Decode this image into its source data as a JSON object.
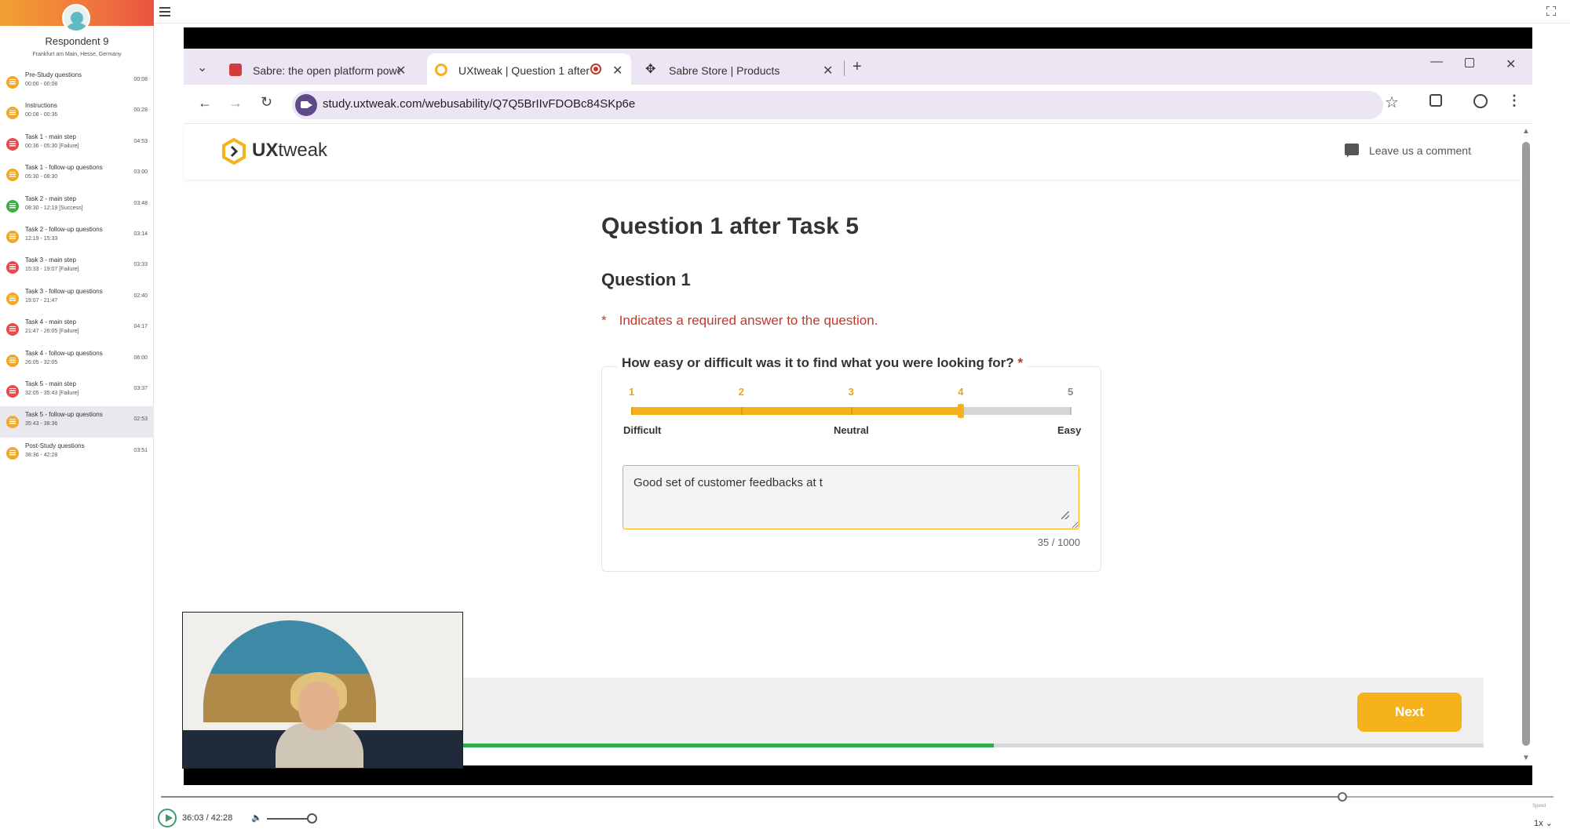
{
  "sidebar": {
    "respondent_name": "Respondent 9",
    "respondent_location": "Frankfurt am Main, Hesse, Germany",
    "items": [
      {
        "name": "Pre-Study questions",
        "range": "00:00 - 00:08",
        "duration": "00:08",
        "color": "#f4a825"
      },
      {
        "name": "Instructions",
        "range": "00:08 - 00:36",
        "duration": "00:28",
        "color": "#f4a825"
      },
      {
        "name": "Task 1 - main step",
        "range": "00:36 - 05:30 [Failure]",
        "duration": "04:53",
        "color": "#e94b4b"
      },
      {
        "name": "Task 1 - follow-up questions",
        "range": "05:30 - 08:30",
        "duration": "03:00",
        "color": "#f4a825"
      },
      {
        "name": "Task 2 - main step",
        "range": "08:30 - 12:19 [Success]",
        "duration": "03:48",
        "color": "#3fae49"
      },
      {
        "name": "Task 2 - follow-up questions",
        "range": "12:19 - 15:33",
        "duration": "03:14",
        "color": "#f4a825"
      },
      {
        "name": "Task 3 - main step",
        "range": "15:33 - 19:07 [Failure]",
        "duration": "03:33",
        "color": "#e94b4b"
      },
      {
        "name": "Task 3 - follow-up questions",
        "range": "19:07 - 21:47",
        "duration": "02:40",
        "color": "#f4a825"
      },
      {
        "name": "Task 4 - main step",
        "range": "21:47 - 26:05 [Failure]",
        "duration": "04:17",
        "color": "#e94b4b"
      },
      {
        "name": "Task 4 - follow-up questions",
        "range": "26:05 - 32:05",
        "duration": "06:00",
        "color": "#f4a825"
      },
      {
        "name": "Task 5 - main step",
        "range": "32:05 - 35:43 [Failure]",
        "duration": "03:37",
        "color": "#e94b4b"
      },
      {
        "name": "Task 5 - follow-up questions",
        "range": "35:43 - 38:36",
        "duration": "02:53",
        "color": "#f4a825",
        "active": true
      },
      {
        "name": "Post-Study questions",
        "range": "38:36 - 42:28",
        "duration": "03:51",
        "color": "#f4a825"
      }
    ]
  },
  "browser": {
    "tabs": [
      {
        "title": "Sabre: the open platform powe",
        "favicon": "sabre-icon"
      },
      {
        "title": "UXtweak | Question 1 after",
        "favicon": "uxtweak-icon",
        "active": true,
        "recording": true
      },
      {
        "title": "Sabre Store | Products",
        "favicon": "sabre-store-icon"
      }
    ],
    "new_tab": "+",
    "url": "study.uxtweak.com/webusability/Q7Q5BrIIvFDOBc84SKp6e"
  },
  "study": {
    "logo_bold": "UX",
    "logo_rest": "tweak",
    "comment_label": "Leave us a comment",
    "title": "Question 1 after Task 5",
    "subtitle": "Question 1",
    "required_star": "*",
    "required_note": "Indicates a required answer to the question.",
    "question": "How easy or difficult was it to find what you were looking for?",
    "scale": {
      "ticks": [
        "1",
        "2",
        "3",
        "4",
        "5"
      ],
      "selected": 4,
      "min_label": "Difficult",
      "mid_label": "Neutral",
      "max_label": "Easy"
    },
    "answer": "Good set of customer feedbacks at t",
    "counter": "35 / 1000",
    "next_label": "Next",
    "progress": 0.52
  },
  "player": {
    "timecode": "36:03 / 42:28",
    "position": 0.849,
    "speed_label": "Speed",
    "speed": "1x ⌄"
  },
  "colors": {
    "accent": "#f6b21b",
    "success": "#36a852",
    "error": "#c0392b"
  }
}
